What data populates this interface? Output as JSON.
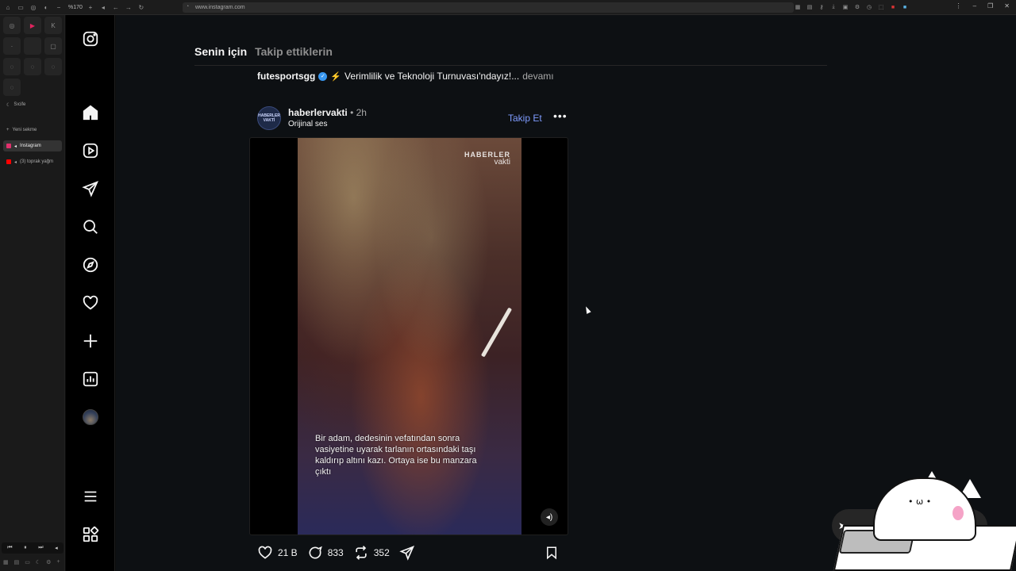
{
  "browser": {
    "zoom": "%170",
    "url": "www.instagram.com",
    "sidebar": {
      "split_label": "Sıcife",
      "new_tab_label": "Yeni sekme",
      "tabs": [
        {
          "label": "Instagram",
          "active": true,
          "icon": "instagram-icon"
        },
        {
          "label": "(3) toprak yağm",
          "active": false,
          "icon": "youtube-icon"
        }
      ]
    }
  },
  "instagram": {
    "nav": [
      "instagram-logo",
      "home-icon",
      "reels-icon",
      "messages-icon",
      "search-icon",
      "explore-icon",
      "notifications-icon",
      "create-icon",
      "dashboard-icon",
      "profile-avatar",
      "more-menu-icon",
      "threads-icon"
    ],
    "feed_tabs": {
      "for_you": "Senin için",
      "following": "Takip ettiklerin"
    },
    "previous_post": {
      "username": "futesportsgg",
      "caption": "Verimlilik ve Teknoloji Turnuvası'ndayız!...",
      "more_label": "devamı"
    },
    "post": {
      "username": "haberlervakti",
      "time": "• 2h",
      "audio": "Orijinal ses",
      "follow_label": "Takip Et",
      "avatar_text": "HABERLER VAKTİ",
      "watermark_line1": "HABERLER",
      "watermark_line2": "vakti",
      "video_caption": "Bir adam, dedesinin vefatından sonra vasiyetine uyarak tarlanın ortasındaki taşı kaldırıp altını kazı. Ortaya ise bu manzara çıktı",
      "likes": "21 B",
      "comments": "833",
      "reposts": "352"
    }
  },
  "colors": {
    "accent_link": "#7f9cff",
    "verified": "#3897f0",
    "background": "#0d1013"
  }
}
